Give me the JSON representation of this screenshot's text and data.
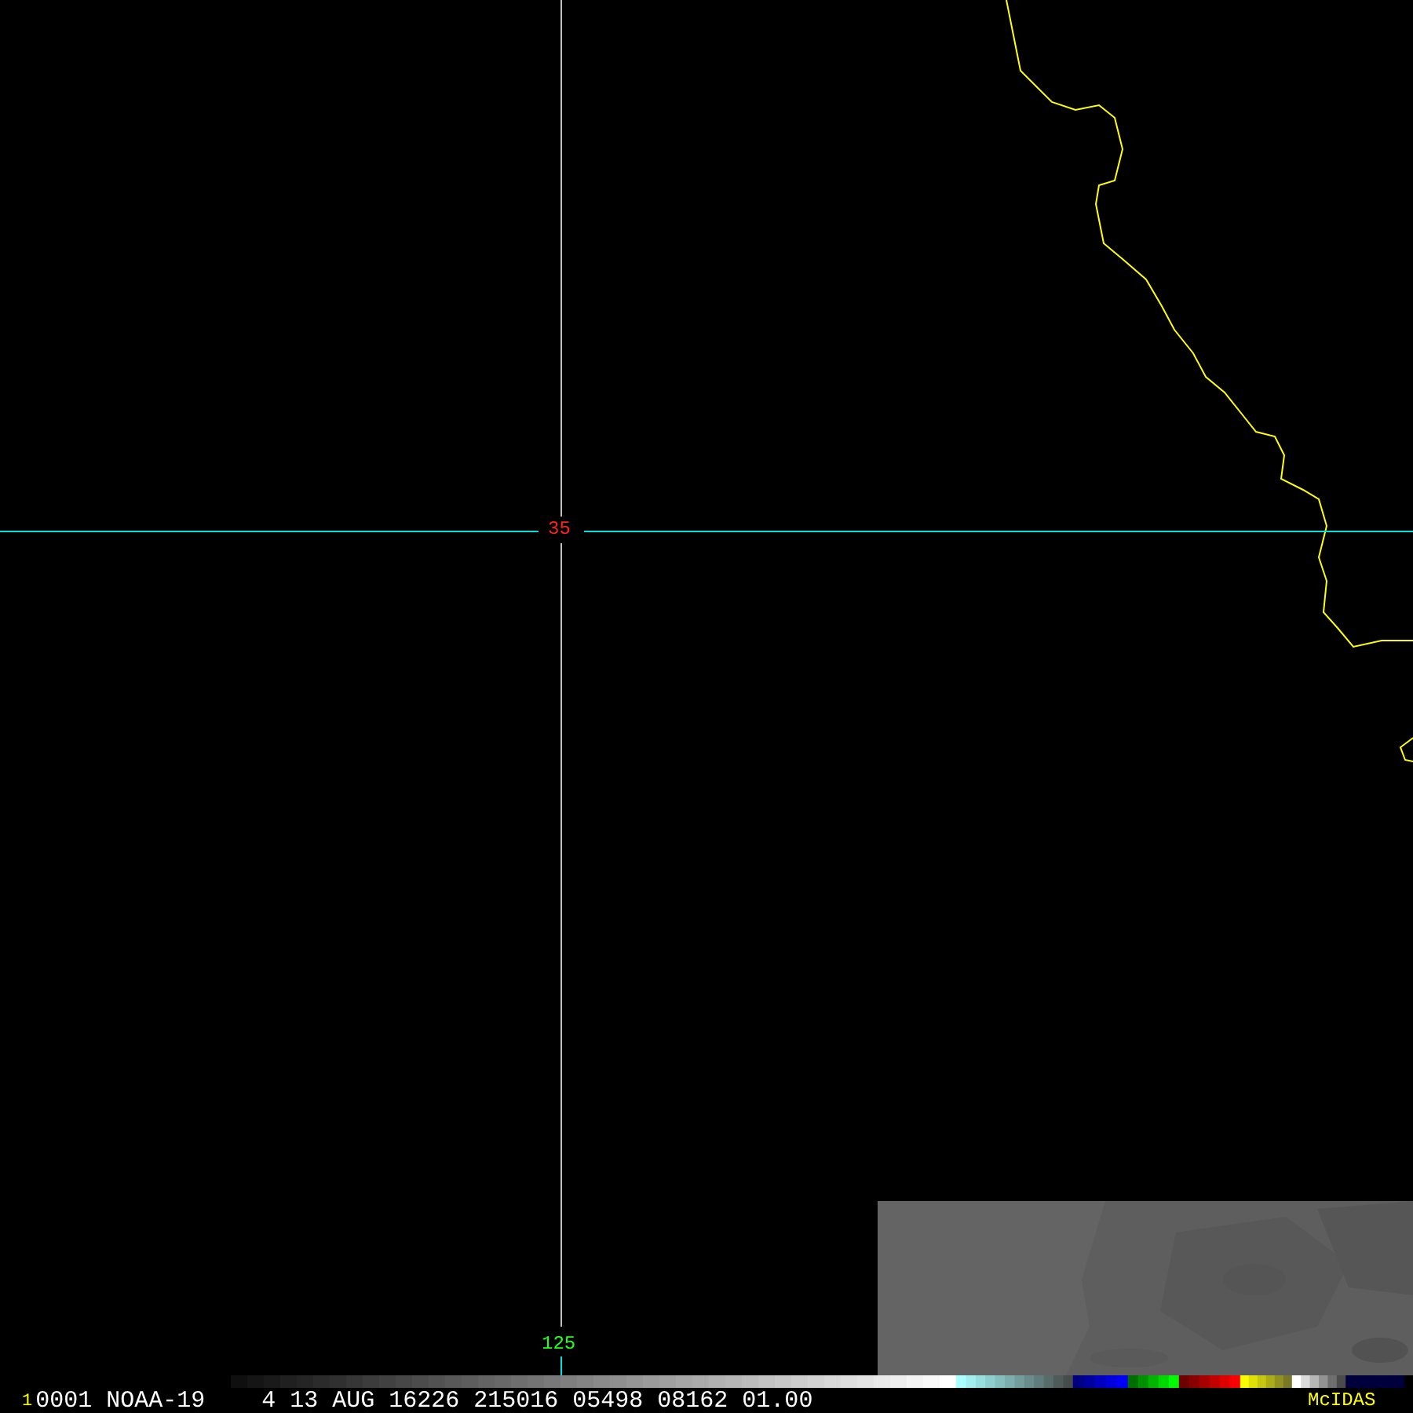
{
  "map": {
    "latitude_label": "35",
    "longitude_label": "125"
  },
  "status_bar": {
    "frame": "1",
    "info": "0001 NOAA-19    4 13 AUG 16226 215016 05498 08162 01.00",
    "logo": "McIDAS"
  }
}
